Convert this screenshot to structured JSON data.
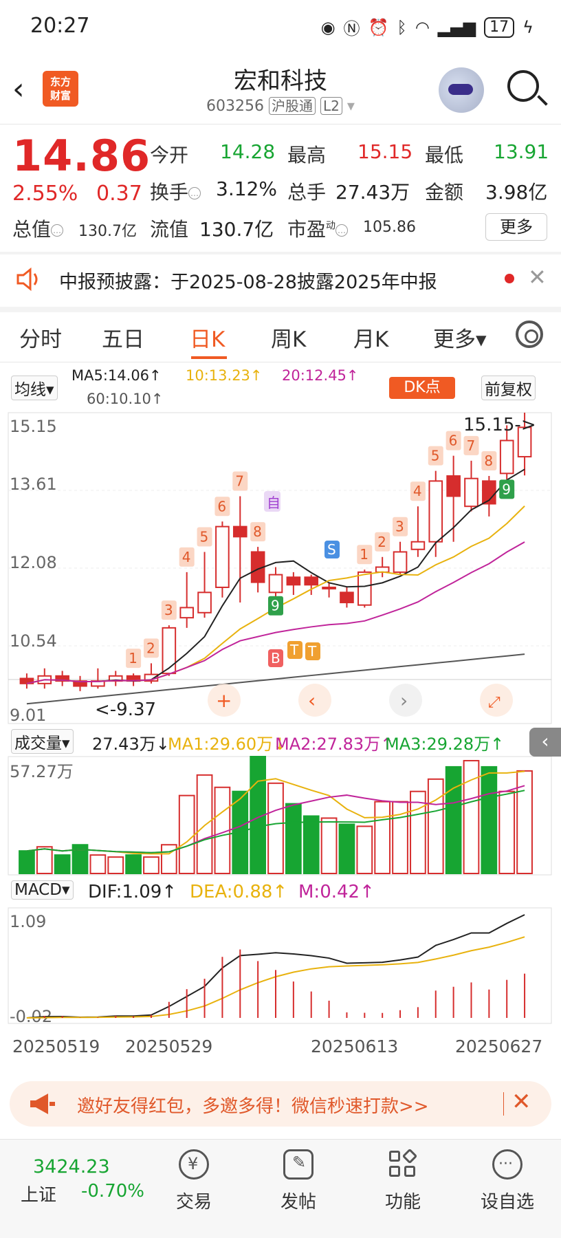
{
  "status_bar": {
    "time": "20:27",
    "battery": "17"
  },
  "header": {
    "title": "宏和科技",
    "code": "603256",
    "market_tag": "沪股通",
    "level_tag": "L2",
    "logo_line1": "东方",
    "logo_line2": "财富"
  },
  "quote": {
    "price": "14.86",
    "change_pct": "2.55%",
    "change_amt": "0.37",
    "open_label": "今开",
    "open": "14.28",
    "high_label": "最高",
    "high": "15.15",
    "low_label": "最低",
    "low": "13.91",
    "turnover_label": "换手",
    "turnover": "3.12%",
    "volume_label": "总手",
    "volume": "27.43万",
    "amount_label": "金额",
    "amount": "3.98亿",
    "mktcap_label": "总值",
    "mktcap": "130.7亿",
    "float_label": "流值",
    "float": "130.7亿",
    "pe_label": "市盈",
    "pe_sup": "动",
    "pe": "105.86",
    "more_label": "更多"
  },
  "notice": {
    "text": "中报预披露：于2025-08-28披露2025年中报"
  },
  "tabs": [
    "分时",
    "五日",
    "日K",
    "周K",
    "月K",
    "更多▾"
  ],
  "active_tab": "日K",
  "ma": {
    "selector": "均线▾",
    "ma5": "MA5:14.06↑",
    "ma10": "10:13.23↑",
    "ma20": "20:12.45↑",
    "ma60": "60:10.10↑",
    "dk_label": "DK点",
    "adjust_label": "前复权"
  },
  "kline": {
    "y_labels": [
      "15.15",
      "13.61",
      "12.08",
      "10.54",
      "9.01"
    ],
    "max_label": "15.15->",
    "min_label": "<-9.37",
    "counts": [
      "1",
      "2",
      "3",
      "4",
      "5",
      "6",
      "7",
      "8",
      "9",
      "1",
      "2",
      "3",
      "4",
      "5",
      "6",
      "7",
      "8",
      "9"
    ],
    "signal_self": "自",
    "signal_s": "S",
    "signal_b": "B",
    "signal_t1": "T",
    "signal_t2": "T"
  },
  "volume": {
    "selector": "成交量▾",
    "value": "27.43万↓",
    "ma1": "MA1:29.60万↓",
    "ma2": "MA2:27.83万↑",
    "ma3": "MA3:29.28万↑",
    "y_label": "57.27万"
  },
  "macd": {
    "selector": "MACD▾",
    "dif": "DIF:1.09↑",
    "dea": "DEA:0.88↑",
    "m": "M:0.42↑",
    "y_top": "1.09",
    "y_bottom": "-0.02"
  },
  "dates": [
    "20250519",
    "20250529",
    "20250613",
    "20250627"
  ],
  "banner": {
    "text": "邀好友得红包，多邀多得！微信秒速打款>>"
  },
  "bottom": {
    "index_value": "3424.23",
    "index_name": "上证",
    "index_change": "-0.70%",
    "nav": [
      "交易",
      "发帖",
      "功能",
      "设自选"
    ]
  },
  "chart_data": {
    "type": "candlestick",
    "candles": [
      {
        "o": 9.9,
        "c": 9.8,
        "h": 10.0,
        "l": 9.7
      },
      {
        "o": 9.8,
        "c": 9.95,
        "h": 10.1,
        "l": 9.7
      },
      {
        "o": 9.95,
        "c": 9.85,
        "h": 10.05,
        "l": 9.75
      },
      {
        "o": 9.85,
        "c": 9.75,
        "h": 9.95,
        "l": 9.65
      },
      {
        "o": 9.75,
        "c": 9.85,
        "h": 10.1,
        "l": 9.7
      },
      {
        "o": 9.85,
        "c": 9.95,
        "h": 10.05,
        "l": 9.75
      },
      {
        "o": 9.95,
        "c": 9.85,
        "h": 10.0,
        "l": 9.75
      },
      {
        "o": 9.85,
        "c": 9.98,
        "h": 10.2,
        "l": 9.8
      },
      {
        "o": 10.0,
        "c": 10.9,
        "h": 10.95,
        "l": 9.95
      },
      {
        "o": 11.1,
        "c": 11.3,
        "h": 12.0,
        "l": 10.9
      },
      {
        "o": 11.2,
        "c": 11.6,
        "h": 12.4,
        "l": 11.1
      },
      {
        "o": 11.7,
        "c": 12.9,
        "h": 13.0,
        "l": 11.5
      },
      {
        "o": 12.9,
        "c": 12.7,
        "h": 13.5,
        "l": 11.4
      },
      {
        "o": 12.4,
        "c": 11.8,
        "h": 12.5,
        "l": 11.6
      },
      {
        "o": 11.6,
        "c": 11.95,
        "h": 12.1,
        "l": 11.5
      },
      {
        "o": 11.9,
        "c": 11.75,
        "h": 12.0,
        "l": 11.55
      },
      {
        "o": 11.9,
        "c": 11.75,
        "h": 11.95,
        "l": 11.55
      },
      {
        "o": 11.7,
        "c": 11.7,
        "h": 11.8,
        "l": 11.5
      },
      {
        "o": 11.6,
        "c": 11.4,
        "h": 11.7,
        "l": 11.3
      },
      {
        "o": 11.35,
        "c": 12.0,
        "h": 12.05,
        "l": 11.3
      },
      {
        "o": 12.0,
        "c": 12.1,
        "h": 12.3,
        "l": 11.9
      },
      {
        "o": 12.0,
        "c": 12.4,
        "h": 12.6,
        "l": 11.95
      },
      {
        "o": 12.45,
        "c": 12.6,
        "h": 13.3,
        "l": 12.3
      },
      {
        "o": 12.6,
        "c": 13.8,
        "h": 14.0,
        "l": 12.3
      },
      {
        "o": 13.9,
        "c": 13.5,
        "h": 14.3,
        "l": 12.6
      },
      {
        "o": 13.3,
        "c": 13.85,
        "h": 14.2,
        "l": 13.2
      },
      {
        "o": 13.8,
        "c": 13.35,
        "h": 13.9,
        "l": 13.1
      },
      {
        "o": 13.95,
        "c": 14.6,
        "h": 14.9,
        "l": 13.8
      },
      {
        "o": 14.28,
        "c": 14.86,
        "h": 15.15,
        "l": 13.91
      }
    ],
    "volumes": [
      11,
      13,
      9,
      14,
      9,
      8,
      9,
      8,
      14,
      38,
      48,
      42,
      40,
      57,
      44,
      34,
      28,
      27,
      24,
      23,
      35,
      35,
      40,
      46,
      52,
      55,
      52,
      40,
      50
    ],
    "ylim": [
      9.01,
      15.15
    ]
  }
}
